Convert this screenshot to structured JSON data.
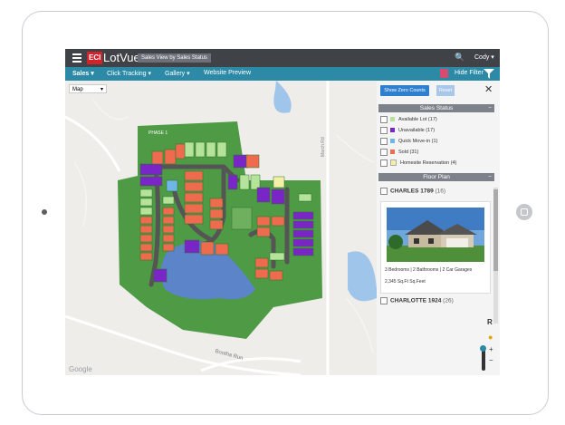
{
  "app": {
    "logo_badge": "ECI",
    "logo_name": "LotVue",
    "view_title": "Sales View by Sales Status",
    "user": "Cody ▾"
  },
  "nav": {
    "items": [
      "Sales ▾",
      "Click Tracking ▾",
      "Gallery ▾",
      "Website Preview"
    ],
    "hide_filter": "Hide Filter"
  },
  "map": {
    "layer_select": "Map",
    "phase_label": "PHASE 1",
    "road_labels": [
      "March Rd",
      "Bootha Run"
    ],
    "watermark": "Google"
  },
  "panel": {
    "show_zero_button": "Show Zero Counts",
    "reset_button": "Reset",
    "close_icon": "✕",
    "sales_status_title": "Sales Status",
    "statuses": [
      {
        "label": "Available Lot (17)",
        "color": "#b6e39a"
      },
      {
        "label": "Unavailable (17)",
        "color": "#7a26c7"
      },
      {
        "label": "Quick Move-in (1)",
        "color": "#6fb6e6"
      },
      {
        "label": "Sold (31)",
        "color": "#ee6b4d"
      },
      {
        "label": "Homesite Reservation (4)",
        "color": "#f4f0a8"
      }
    ],
    "floor_plan_title": "Floor Plan",
    "plans": [
      {
        "name": "CHARLES 1789",
        "count": "(16)"
      },
      {
        "name": "CHARLOTTE 1924",
        "count": "(26)"
      }
    ],
    "plan_specs": "3 Bedrooms | 2 Bathrooms | 2 Car Garages",
    "plan_sqft": "2,345 Sq.Ft Sq.Feet",
    "map_controls": {
      "rotate": "R",
      "zoom_in": "+",
      "zoom_out": "−"
    }
  },
  "colors": {
    "topbar": "#3f4348",
    "nav": "#2c8aa6",
    "brand_red": "#d3222a",
    "community_green": "#4e9a45",
    "pond": "#5b84c9"
  }
}
